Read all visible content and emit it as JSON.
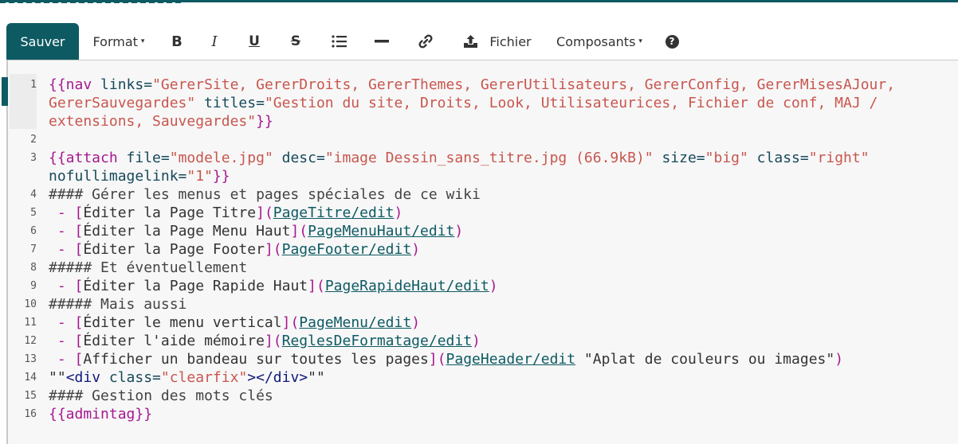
{
  "toolbar": {
    "save": "Sauver",
    "format": "Format",
    "bold": "B",
    "italic": "I",
    "underline": "U",
    "strike": "S",
    "file": "Fichier",
    "components": "Composants",
    "help": "?"
  },
  "editor": {
    "line_numbers": [
      "1",
      "2",
      "3",
      "4",
      "5",
      "6",
      "7",
      "8",
      "9",
      "10",
      "11",
      "12",
      "13",
      "14",
      "15",
      "16"
    ],
    "l1a": "{{nav links=\"GererSite, GererDroits, GererThemes, GererUtilisateurs, GererConfig, GererMisesAJour,",
    "l1b": "GererSauvegardes\" titles=\"Gestion du site, Droits, Look, Utilisateurices, Fichier de conf, MAJ /",
    "l1c": "extensions, Sauvegardes\"}}",
    "l3a": "{{attach file=\"modele.jpg\" desc=\"image Dessin_sans_titre.jpg (66.9kB)\" size=\"big\" class=\"right\"",
    "l3b": "nofullimagelink=\"1\"}}",
    "l4": "#### Gérer les menus et pages spéciales de ce wiki",
    "l5": [
      " - ",
      "[Éditer la Page Titre]",
      "(",
      "PageTitre/edit",
      ")"
    ],
    "l6": [
      " - ",
      "[Éditer la Page Menu Haut]",
      "(",
      "PageMenuHaut/edit",
      ")"
    ],
    "l7": [
      " - ",
      "[Éditer la Page Footer]",
      "(",
      "PageFooter/edit",
      ")"
    ],
    "l8": "##### Et éventuellement",
    "l9": [
      " - ",
      "[Éditer la Page Rapide Haut]",
      "(",
      "PageRapideHaut/edit",
      ")"
    ],
    "l10": "##### Mais aussi",
    "l11": [
      " - ",
      "[Éditer le menu vertical]",
      "(",
      "PageMenu/edit",
      ")"
    ],
    "l12": [
      " - ",
      "[Éditer l'aide mémoire]",
      "(",
      "ReglesDeFormatage/edit",
      ")"
    ],
    "l13": [
      " - ",
      "[Afficher un bandeau sur toutes les pages]",
      "(",
      "PageHeader/edit",
      " \"Aplat de couleurs ou images\"",
      ")"
    ],
    "l14": "\"\"<div class=\"clearfix\"></div>\"\"",
    "l15": "#### Gestion des mots clés",
    "l16": "{{admintag}}"
  }
}
